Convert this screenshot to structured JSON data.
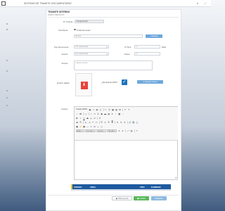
{
  "app": {
    "title": "SISTEMA DE TRAMITE DOCUMENTARIO"
  },
  "topbar": {
    "icons": [
      "user-icon",
      "expand-icon"
    ]
  },
  "sidebar": {
    "icons": [
      "menu-icon"
    ]
  },
  "form": {
    "header": "TRAMITE INTERNO",
    "subheader": "NUEVO REGISTRO",
    "tramite_no_label": "N° Tramite:",
    "tramite_no_value": "Autogenerado",
    "remitente_label": "Remitente:",
    "todas_areas_label": "Todas las areas",
    "search_placeholder": "Buscar",
    "agregar_label": "Agregar",
    "tipo_documento_label": "Tipo Documento:",
    "tipo_documento_value": "Por seleccionar",
    "nro_doc_label": "N° Doc:",
    "nro_doc_value": "nº",
    "year_value": "2022",
    "asunto_label": "Asunto:",
    "asunto_value": "Por seleccionar",
    "folios_label": "Folios:",
    "folios_value": "nº",
    "asunto2_label": "Asunto:",
    "asunto2_placeholder": "Ingrese asunto",
    "archivo_label": "Archivo digital:",
    "remplazar_label": "¿Remplazar PDF?",
    "agregar_anexo_label": "Agregar anexo",
    "cuerpo_label": "Cuerpo:"
  },
  "editor": {
    "row1": [
      "Fuente HTML"
    ],
    "styles": [
      "Estilo",
      "Formato",
      "Fuente",
      "Tamaño"
    ]
  },
  "table": {
    "columns": [
      "CODIGO",
      "AREA",
      "TIPO",
      "ELIMINAR"
    ]
  },
  "footer": {
    "view_label": "Vista previa",
    "save_label": "Grabar",
    "register_label": "Registrar"
  },
  "colors": {
    "accent": "#1e5aa0",
    "save": "#5cb85c",
    "button": "#6fa8dc",
    "pdf": "#e8423a"
  }
}
